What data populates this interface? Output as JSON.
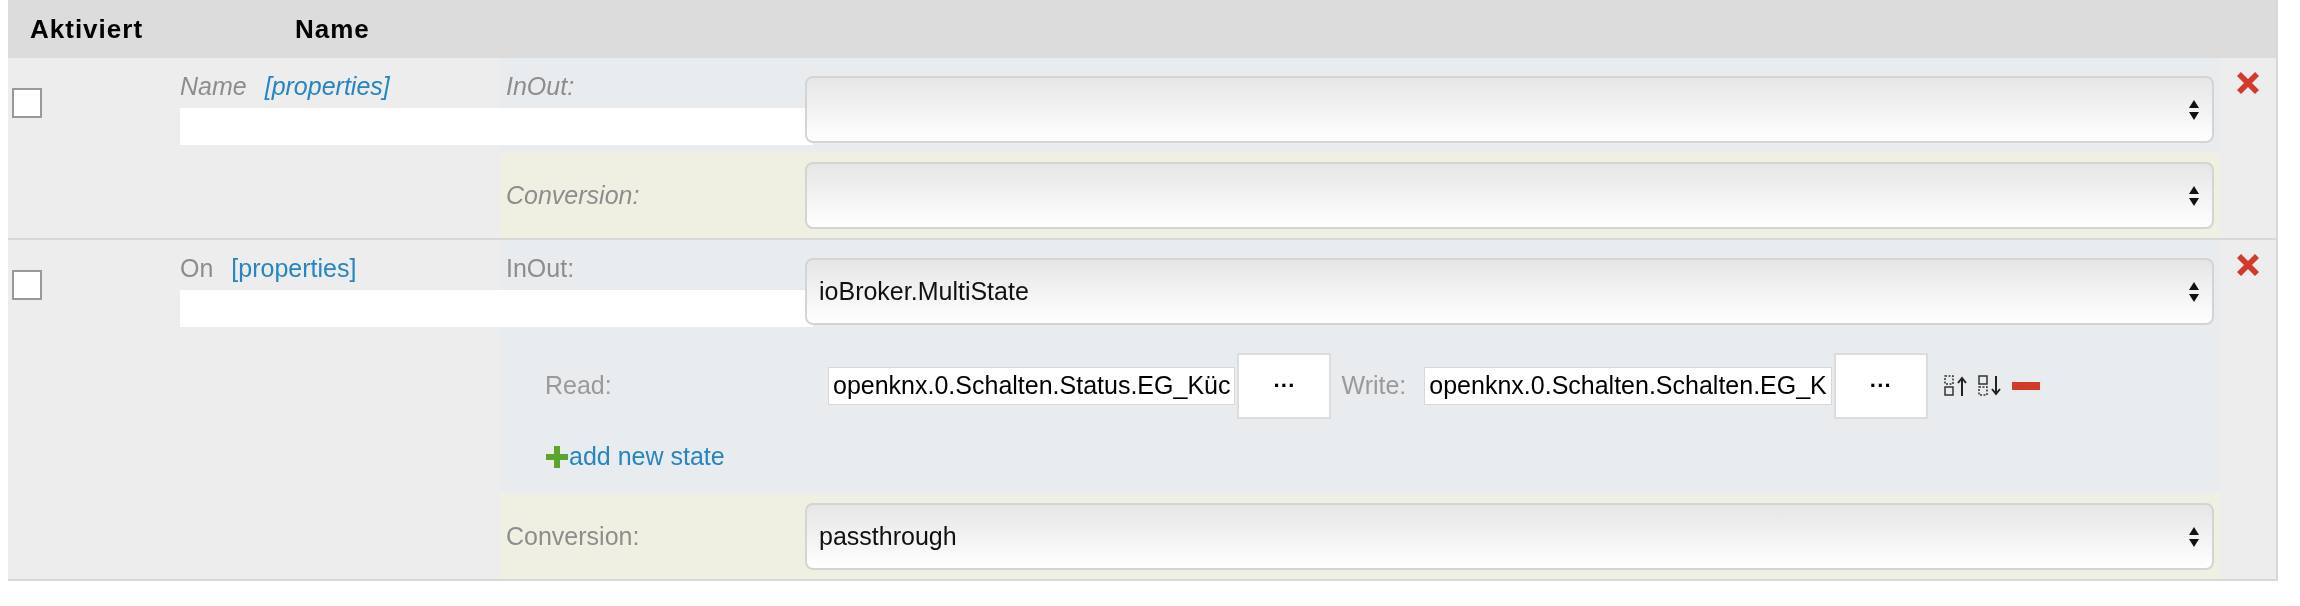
{
  "header": {
    "columns": [
      "Aktiviert",
      "Name"
    ]
  },
  "rows": [
    {
      "checked": false,
      "empty": true,
      "name": "Name",
      "properties_link": "[properties]",
      "inout_label": "InOut:",
      "conversion_label": "Conversion:"
    },
    {
      "checked": false,
      "empty": false,
      "name": "On",
      "properties_link": "[properties]",
      "inout_label": "InOut:",
      "inout_value": "ioBroker.MultiState",
      "states": [
        {
          "read_label": "Read:",
          "read_value": "openknx.0.Schalten.Status.EG_Küc",
          "read_browse": "···",
          "write_label": "Write:",
          "write_value": "openknx.0.Schalten.Schalten.EG_K",
          "write_browse": "···"
        }
      ],
      "add_state": "add new state",
      "conversion_label": "Conversion:",
      "conversion_value": "passthrough"
    }
  ]
}
